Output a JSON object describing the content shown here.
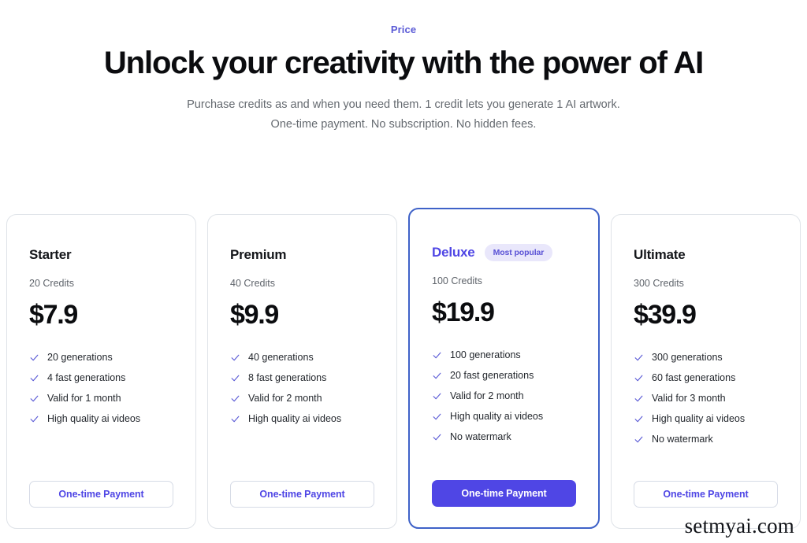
{
  "header": {
    "eyebrow": "Price",
    "headline": "Unlock your creativity with the power of AI",
    "subhead": "Purchase credits as and when you need them. 1 credit lets you generate 1 AI artwork. One-time payment. No subscription. No hidden fees."
  },
  "colors": {
    "accent": "#4f46e5",
    "eyebrow": "#5b5bd6",
    "check": "#5b5bd6",
    "featured_border": "#3f62c8",
    "badge_bg": "#e9e7fb",
    "badge_text": "#5a52d5",
    "card_border": "#dfe3e8",
    "heading": "#0b0c0f",
    "muted_text": "#64696f"
  },
  "plans": [
    {
      "name": "Starter",
      "credits": "20 Credits",
      "price": "$7.9",
      "featured": false,
      "badge": null,
      "features": [
        "20 generations",
        "4 fast generations",
        "Valid for 1 month",
        "High quality ai videos"
      ],
      "cta_label": "One-time Payment"
    },
    {
      "name": "Premium",
      "credits": "40 Credits",
      "price": "$9.9",
      "featured": false,
      "badge": null,
      "features": [
        "40 generations",
        "8 fast generations",
        "Valid for 2 month",
        "High quality ai videos"
      ],
      "cta_label": "One-time Payment"
    },
    {
      "name": "Deluxe",
      "credits": "100 Credits",
      "price": "$19.9",
      "featured": true,
      "badge": "Most popular",
      "features": [
        "100 generations",
        "20 fast generations",
        "Valid for 2 month",
        "High quality ai videos",
        "No watermark"
      ],
      "cta_label": "One-time Payment"
    },
    {
      "name": "Ultimate",
      "credits": "300 Credits",
      "price": "$39.9",
      "featured": false,
      "badge": null,
      "features": [
        "300 generations",
        "60 fast generations",
        "Valid for 3 month",
        "High quality ai videos",
        "No watermark"
      ],
      "cta_label": "One-time Payment"
    }
  ],
  "watermark": "setmyai.com"
}
